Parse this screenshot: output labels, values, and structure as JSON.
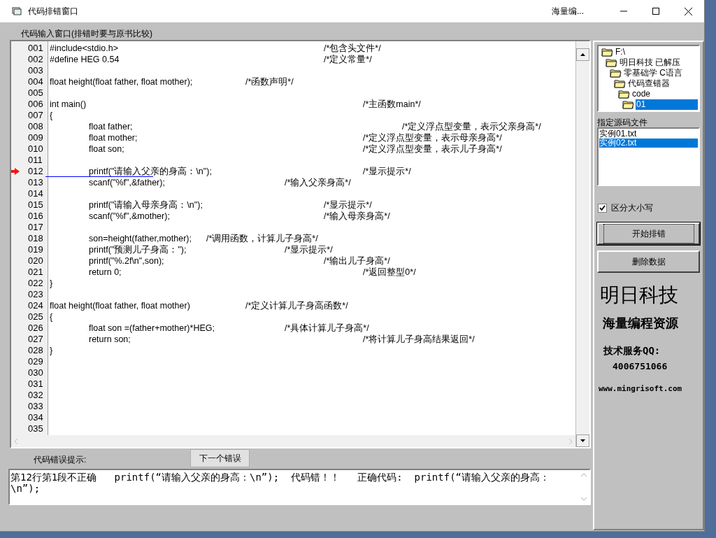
{
  "window": {
    "title": "代码排错窗口",
    "caption_text": "海量编..."
  },
  "editor": {
    "label": "代码输入窗口(排错时要与原书比较)",
    "lines": [
      {
        "number": "001",
        "text": "#include<stdio.h>\t\t\t\t\t\t/*包含头文件*/",
        "error": false
      },
      {
        "number": "002",
        "text": "#define HEG 0.54\t\t\t\t\t\t/*定义常量*/",
        "error": false
      },
      {
        "number": "003",
        "error": false
      },
      {
        "number": "004",
        "text": "float height(float father, float mother);\t\t/*函数声明*/",
        "error": false
      },
      {
        "number": "005",
        "error": false
      },
      {
        "number": "006",
        "text": "int main()\t\t\t\t\t\t\t\t/*主函数main*/",
        "error": false
      },
      {
        "number": "007",
        "text": "{",
        "error": false
      },
      {
        "number": "008",
        "text": "\tfloat father;\t\t\t\t\t\t\t/*定义浮点型变量，表示父亲身高*/",
        "error": false
      },
      {
        "number": "009",
        "text": "\tfloat mother;\t\t\t\t\t\t/*定义浮点型变量，表示母亲身高*/",
        "error": false
      },
      {
        "number": "010",
        "text": "\tfloat son;\t\t\t\t\t\t\t/*定义浮点型变量，表示儿子身高*/",
        "error": false
      },
      {
        "number": "011",
        "error": false
      },
      {
        "number": "012",
        "text": "\tprintf(\"请输入父亲的身高：\\n\");\t\t\t\t/*显示提示*/",
        "error": true
      },
      {
        "number": "013",
        "text": "\tscanf(\"%f\",&father);\t\t\t\t/*输入父亲身高*/",
        "error": false
      },
      {
        "number": "014",
        "error": false
      },
      {
        "number": "015",
        "text": "\tprintf(\"请输入母亲身高：\\n\");\t\t\t\t/*显示提示*/",
        "error": false
      },
      {
        "number": "016",
        "text": "\tscanf(\"%f\",&mother);\t\t\t\t/*输入母亲身高*/",
        "error": false
      },
      {
        "number": "017",
        "error": false
      },
      {
        "number": "018",
        "text": "\tson=height(father,mother);\t/*调用函数，计算儿子身高*/",
        "error": false
      },
      {
        "number": "019",
        "text": "\tprintf(\"预测儿子身高：\");\t\t\t/*显示提示*/",
        "error": false
      },
      {
        "number": "020",
        "text": "\tprintf(\"%.2f\\n\",son);\t\t\t\t\t/*输出儿子身高*/",
        "error": false
      },
      {
        "number": "021",
        "text": "\treturn 0;\t\t\t\t\t\t\t/*返回整型0*/",
        "error": false
      },
      {
        "number": "022",
        "text": "}",
        "error": false
      },
      {
        "number": "023",
        "error": false
      },
      {
        "number": "024",
        "text": "float height(float father, float mother)\t\t/*定义计算儿子身高函数*/",
        "error": false
      },
      {
        "number": "025",
        "text": "{",
        "error": false
      },
      {
        "number": "026",
        "text": "\tfloat son =(father+mother)*HEG;\t\t/*具体计算儿子身高*/",
        "error": false
      },
      {
        "number": "027",
        "text": "\treturn son;\t\t\t\t\t\t/*将计算儿子身高结果返回*/",
        "error": false
      },
      {
        "number": "028",
        "text": "}",
        "error": false
      },
      {
        "number": "029",
        "error": false
      },
      {
        "number": "030",
        "error": false
      },
      {
        "number": "031",
        "error": false
      },
      {
        "number": "032",
        "error": false
      },
      {
        "number": "033",
        "error": false
      },
      {
        "number": "034",
        "error": false
      },
      {
        "number": "035",
        "error": false
      }
    ]
  },
  "error_label": "代码错误提示:",
  "next_button": "下一个错误",
  "error_message": "第12行第1段不正确   printf(“请输入父亲的身高：\\n”);  代码错！！   正确代码:  printf(“请输入父亲的身高：\\n”);",
  "tree": [
    {
      "label": "F:\\",
      "selected": false,
      "children": [
        {
          "label": "明日科技 已解压",
          "selected": false,
          "children": [
            {
              "label": "零基础学 C语言",
              "selected": false,
              "children": [
                {
                  "label": "代码查错器",
                  "selected": false,
                  "children": [
                    {
                      "label": "code",
                      "selected": false,
                      "children": [
                        {
                          "label": "01",
                          "selected": true
                        }
                      ]
                    }
                  ]
                }
              ]
            }
          ]
        }
      ]
    }
  ],
  "files_label": "指定源码文件",
  "files": [
    {
      "name": "实例01.txt",
      "selected": false
    },
    {
      "name": "实例02.txt",
      "selected": true
    }
  ],
  "case_checkbox": {
    "label": "区分大小写",
    "checked": true
  },
  "buttons": [
    {
      "label": "开始排错",
      "focused": true
    },
    {
      "label": "删除数据",
      "focused": false
    }
  ],
  "branding": {
    "title": "明日科技",
    "subtitle": "海量编程资源",
    "qq_label": "技术服务QQ:",
    "qq": "4006751066",
    "url": "www.mingrisoft.com"
  }
}
